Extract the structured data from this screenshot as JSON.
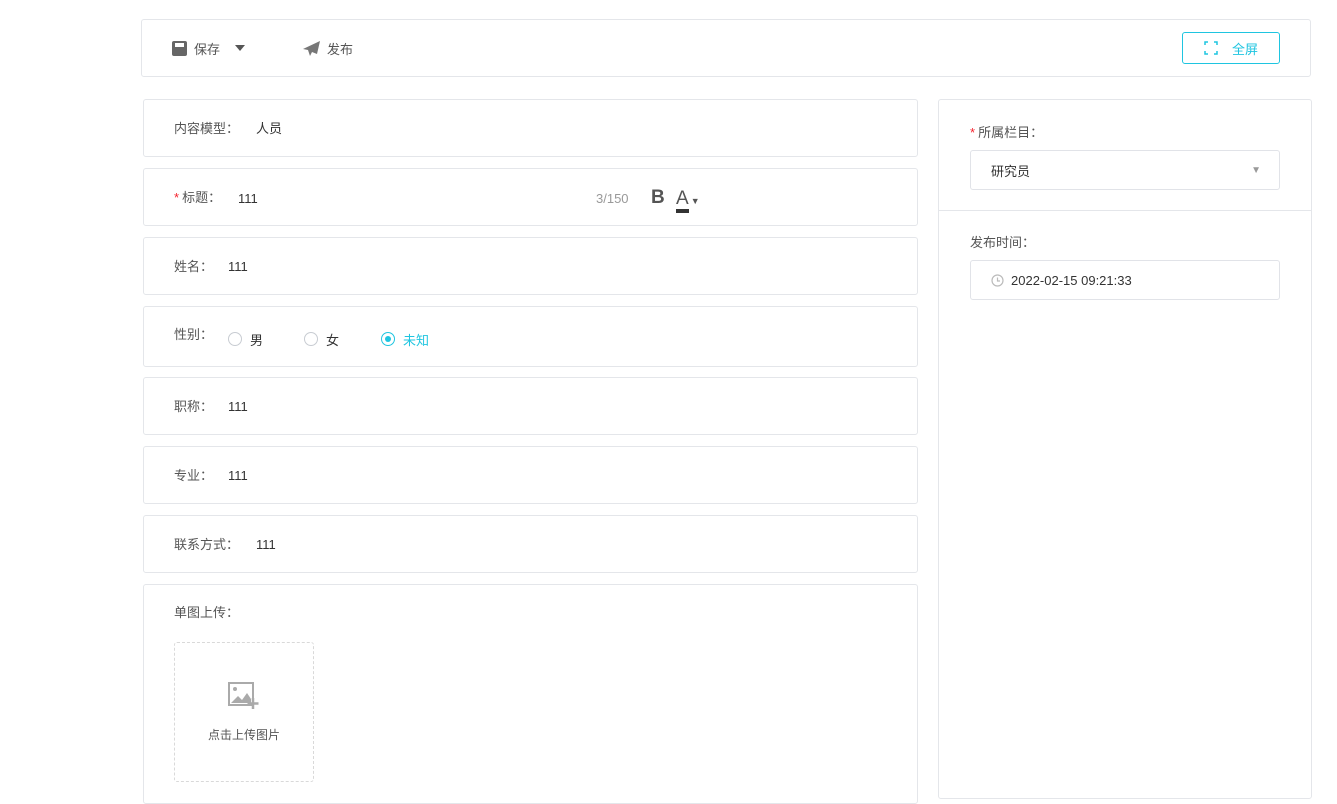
{
  "toolbar": {
    "save": "保存",
    "publish": "发布",
    "fullscreen": "全屏"
  },
  "form": {
    "model_label": "内容模型：",
    "model_value": "人员",
    "title_label": "标题：",
    "title_value": "111",
    "title_count": "3/150",
    "bold": "B",
    "color": "A",
    "name_label": "姓名：",
    "name_value": "111",
    "gender_label": "性别：",
    "gender_options": [
      "男",
      "女",
      "未知"
    ],
    "gender_selected": "未知",
    "jobtitle_label": "职称：",
    "jobtitle_value": "111",
    "major_label": "专业：",
    "major_value": "111",
    "contact_label": "联系方式：",
    "contact_value": "111",
    "image_label": "单图上传：",
    "upload_text": "点击上传图片"
  },
  "side": {
    "category_label": "所属栏目：",
    "category_value": "研究员",
    "publish_time_label": "发布时间：",
    "publish_time_value": "2022-02-15 09:21:33"
  },
  "colors": {
    "accent": "#1fc5e0",
    "required": "#f5222d"
  }
}
